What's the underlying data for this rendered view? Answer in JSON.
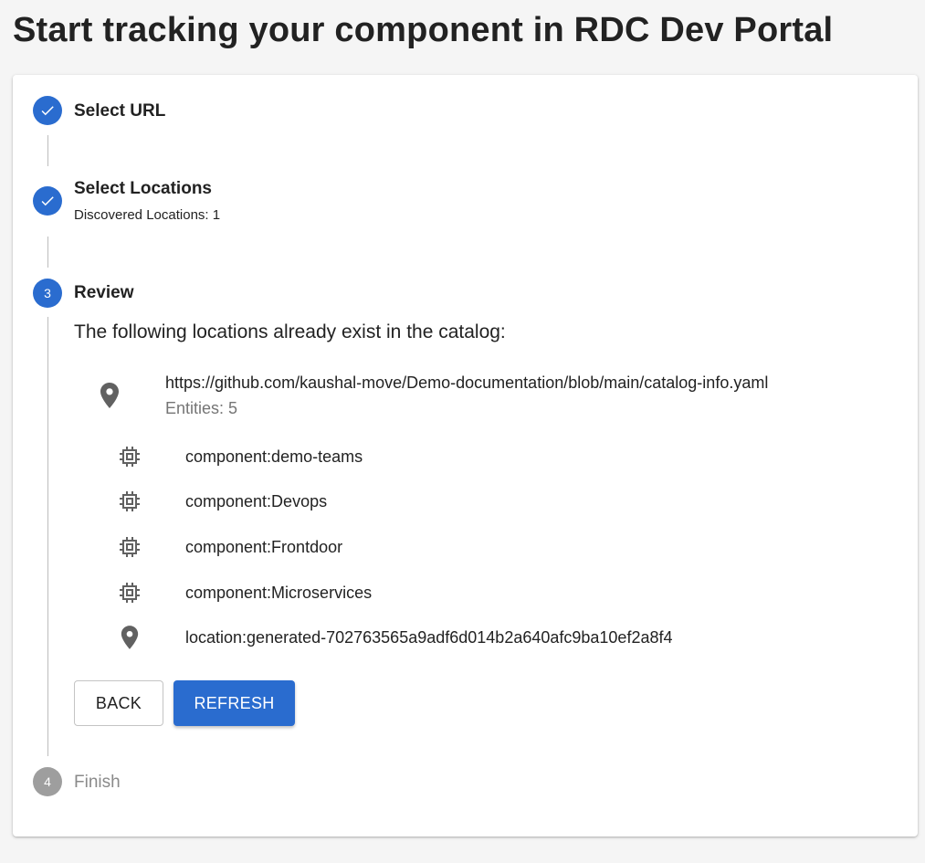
{
  "page": {
    "title": "Start tracking your component in RDC Dev Portal"
  },
  "colors": {
    "accent": "#2a6ccf",
    "pending": "#9e9e9e"
  },
  "stepper": {
    "steps": [
      {
        "label": "Select URL",
        "status": "completed",
        "icon": "check-icon"
      },
      {
        "label": "Select Locations",
        "status": "completed",
        "icon": "check-icon",
        "caption": "Discovered Locations: 1"
      },
      {
        "label": "Review",
        "status": "active",
        "number": "3"
      },
      {
        "label": "Finish",
        "status": "pending",
        "number": "4"
      }
    ]
  },
  "review": {
    "heading": "The following locations already exist in the catalog:",
    "location": {
      "icon": "location-pin-icon",
      "url": "https://github.com/kaushal-move/Demo-documentation/blob/main/catalog-info.yaml",
      "entities_label": "Entities: 5"
    },
    "entities": [
      {
        "icon": "component-chip-icon",
        "label": "component:demo-teams"
      },
      {
        "icon": "component-chip-icon",
        "label": "component:Devops"
      },
      {
        "icon": "component-chip-icon",
        "label": "component:Frontdoor"
      },
      {
        "icon": "component-chip-icon",
        "label": "component:Microservices"
      },
      {
        "icon": "location-pin-icon",
        "label": "location:generated-702763565a9adf6d014b2a640afc9ba10ef2a8f4"
      }
    ],
    "buttons": {
      "back_label": "BACK",
      "refresh_label": "REFRESH"
    }
  }
}
